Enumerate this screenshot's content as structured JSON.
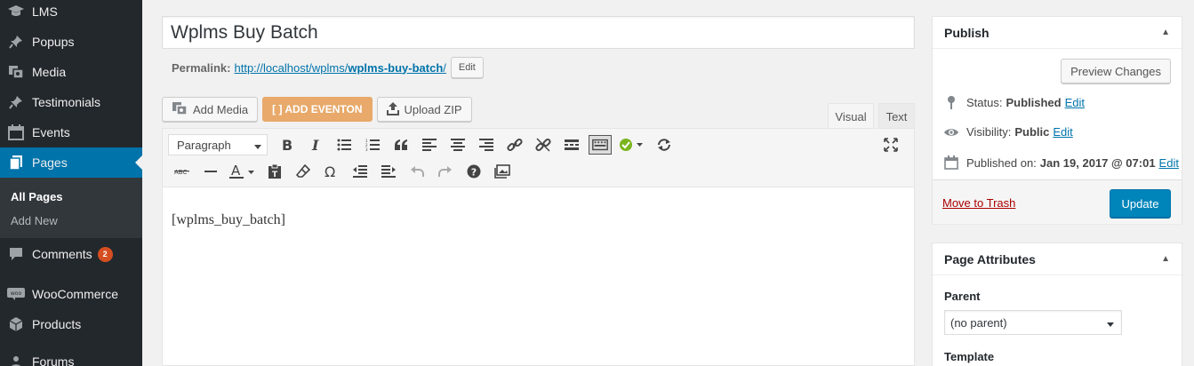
{
  "sidebar": {
    "items": [
      {
        "label": "LMS",
        "icon": "mortarboard-icon"
      },
      {
        "label": "Popups",
        "icon": "pin-icon"
      },
      {
        "label": "Media",
        "icon": "media-icon"
      },
      {
        "label": "Testimonials",
        "icon": "pin-icon"
      },
      {
        "label": "Events",
        "icon": "calendar-icon"
      },
      {
        "label": "Pages",
        "icon": "pages-icon",
        "active": true
      },
      {
        "label": "Comments",
        "icon": "comment-icon",
        "badge": "2"
      },
      {
        "label": "WooCommerce",
        "icon": "woocommerce-icon"
      },
      {
        "label": "Products",
        "icon": "products-icon"
      },
      {
        "label": "Forums",
        "icon": "forums-icon"
      }
    ],
    "submenu": {
      "all_pages": "All Pages",
      "add_new": "Add New"
    }
  },
  "editor": {
    "title": "Wplms Buy Batch",
    "permalink": {
      "label": "Permalink:",
      "url_base": "http://localhost/wplms/",
      "slug": "wplms-buy-batch",
      "trailing": "/",
      "edit_label": "Edit"
    },
    "media_buttons": {
      "add_media": "Add Media",
      "add_eventon": "[ ] ADD EVENTON",
      "upload_zip": "Upload ZIP"
    },
    "tabs": {
      "visual": "Visual",
      "text": "Text"
    },
    "format_select": "Paragraph",
    "content": "[wplms_buy_batch]"
  },
  "publish": {
    "title": "Publish",
    "preview_label": "Preview Changes",
    "status_label": "Status:",
    "status_value": "Published",
    "visibility_label": "Visibility:",
    "visibility_value": "Public",
    "published_label": "Published on:",
    "published_value": "Jan 19, 2017 @ 07:01",
    "edit_label": "Edit",
    "trash_label": "Move to Trash",
    "update_label": "Update"
  },
  "page_attributes": {
    "title": "Page Attributes",
    "parent_label": "Parent",
    "parent_value": "(no parent)",
    "template_label": "Template"
  },
  "colors": {
    "accent": "#0073aa",
    "sidebar_bg": "#23282d",
    "eventon_orange": "#e8a96a",
    "badge": "#d54e21"
  }
}
